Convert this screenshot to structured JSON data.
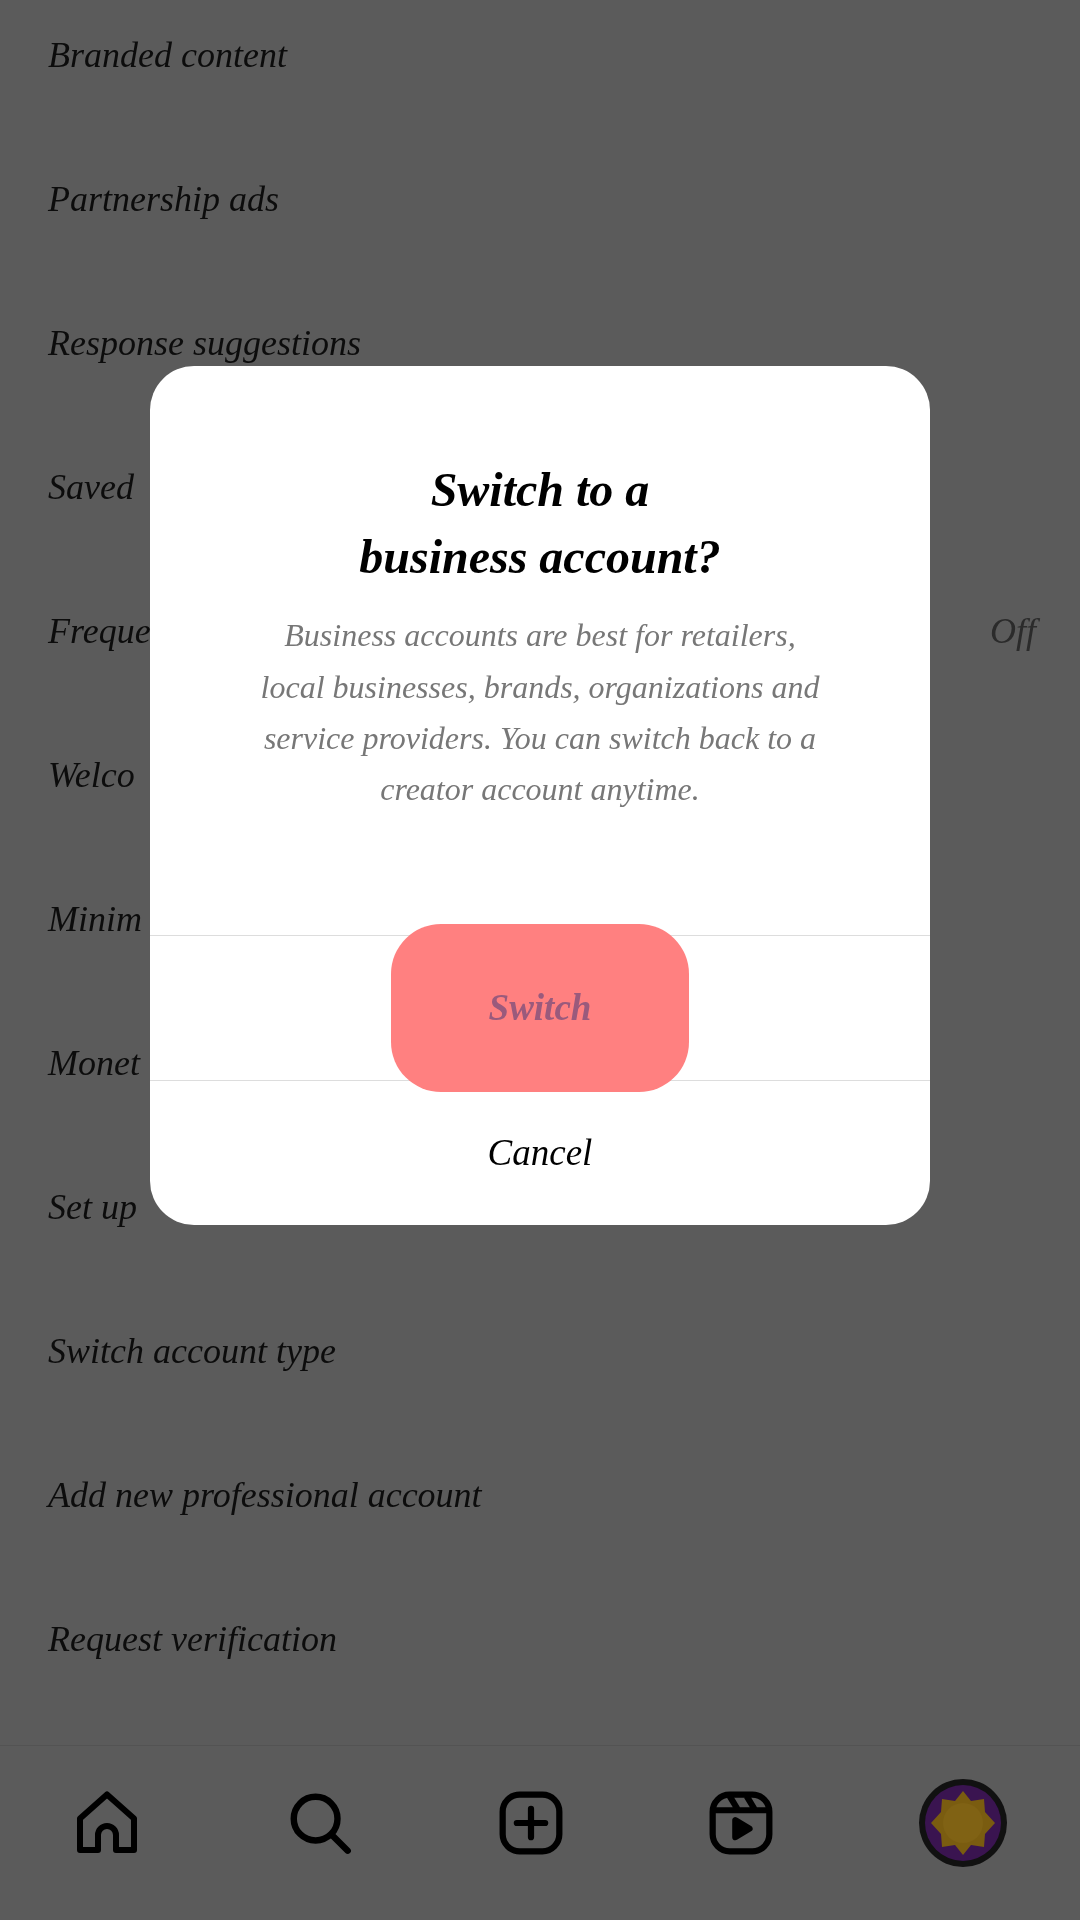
{
  "settings_items": [
    {
      "label": "Branded content"
    },
    {
      "label": "Partnership ads"
    },
    {
      "label": "Response suggestions"
    },
    {
      "label": "Saved"
    },
    {
      "label": "Freque",
      "value": "Off"
    },
    {
      "label": "Welco"
    },
    {
      "label": "Minim"
    },
    {
      "label": "Monet"
    },
    {
      "label": "Set up"
    },
    {
      "label": "Switch account type"
    },
    {
      "label": "Add new professional account"
    },
    {
      "label": "Request verification"
    }
  ],
  "dialog": {
    "title": "Switch to a\nbusiness account?",
    "message": "Business accounts are best for retailers, local businesses, brands, organizations and service providers. You can switch back to a creator account anytime.",
    "buttons": [
      {
        "label": "Switch",
        "kind": "highlighted"
      },
      {
        "label": "Cancel",
        "kind": "plain"
      }
    ]
  }
}
